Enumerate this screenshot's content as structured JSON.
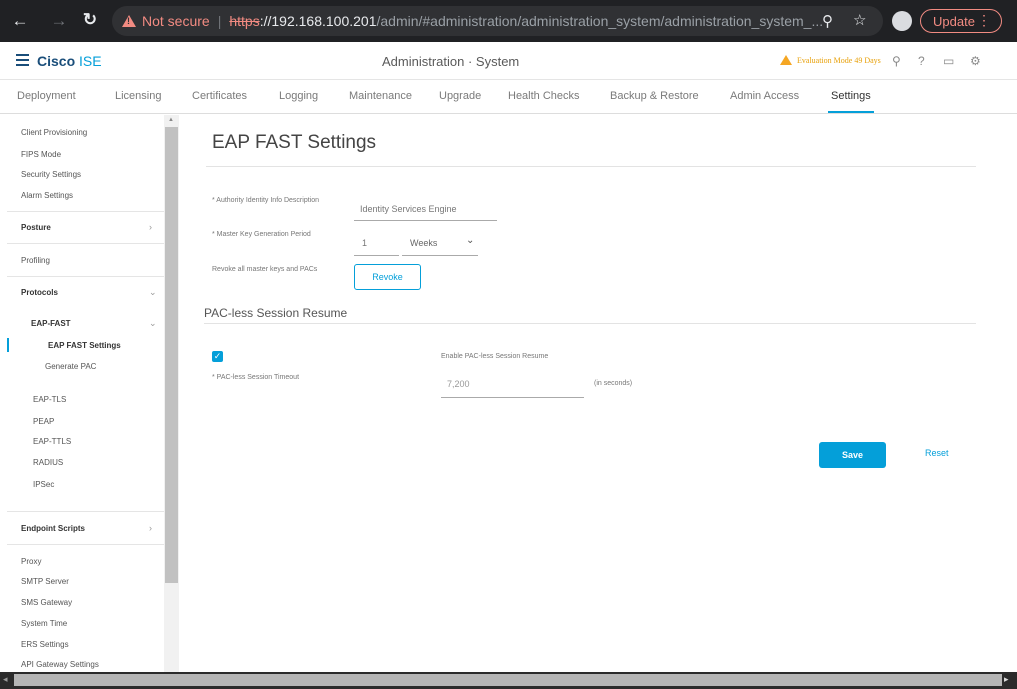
{
  "browser": {
    "not_secure": "Not secure",
    "url_scheme": "https",
    "url_host": "://192.168.100.201",
    "url_path": "/admin/#administration/administration_system/administration_system_...",
    "update_label": "Update"
  },
  "header": {
    "brand_primary": "Cisco",
    "brand_secondary": "ISE",
    "page_title": "Administration · System",
    "evaluation": "Evaluation Mode 49 Days"
  },
  "tabs": [
    {
      "label": "Deployment"
    },
    {
      "label": "Licensing"
    },
    {
      "label": "Certificates"
    },
    {
      "label": "Logging"
    },
    {
      "label": "Maintenance"
    },
    {
      "label": "Upgrade"
    },
    {
      "label": "Health Checks"
    },
    {
      "label": "Backup & Restore"
    },
    {
      "label": "Admin Access"
    },
    {
      "label": "Settings"
    }
  ],
  "sidebar": {
    "items": [
      "Client Provisioning",
      "FIPS Mode",
      "Security Settings",
      "Alarm Settings",
      "Posture",
      "Profiling",
      "Protocols",
      "EAP-FAST",
      "EAP FAST Settings",
      "Generate PAC",
      "EAP-TLS",
      "PEAP",
      "EAP-TTLS",
      "RADIUS",
      "IPSec",
      "Endpoint Scripts",
      "Proxy",
      "SMTP Server",
      "SMS Gateway",
      "System Time",
      "ERS Settings",
      "API Gateway Settings"
    ]
  },
  "main": {
    "title": "EAP FAST Settings",
    "authority_label": "* Authority Identity Info Description",
    "authority_value": "Identity Services Engine",
    "master_key_label": "* Master Key Generation Period",
    "master_key_value": "1",
    "master_key_unit": "Weeks",
    "revoke_label": "Revoke all master keys and PACs",
    "revoke_button": "Revoke",
    "pacless_section": "PAC-less Session Resume",
    "enable_label": "Enable PAC-less Session Resume",
    "timeout_label": "* PAC-less Session Timeout",
    "timeout_value": "7,200",
    "timeout_unit": "(in seconds)",
    "save_button": "Save",
    "reset_link": "Reset"
  },
  "colors": {
    "accent": "#049fd9",
    "brand_dark": "#1a4e7a",
    "warning": "#f5a623",
    "chrome_bg": "#202124"
  }
}
